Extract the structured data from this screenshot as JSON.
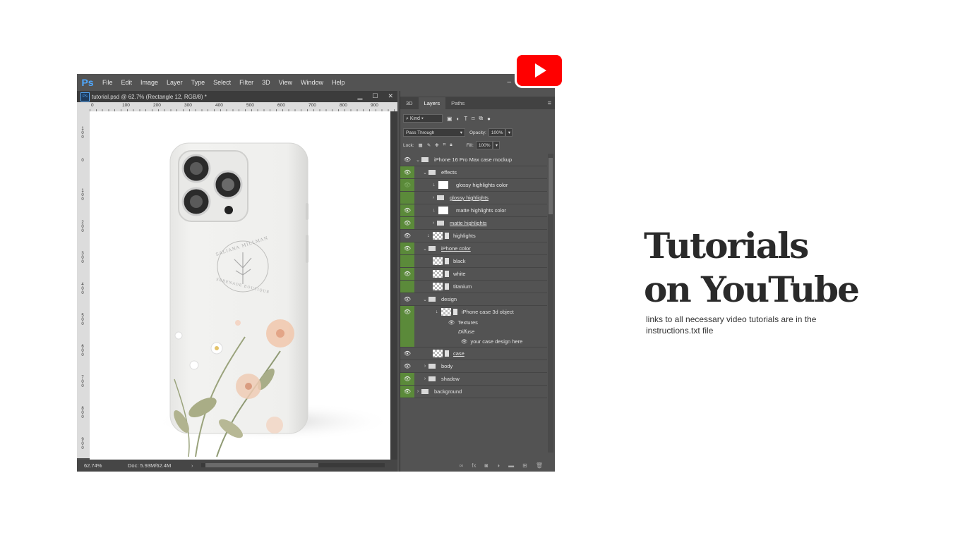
{
  "app": {
    "logo": "Ps",
    "menu": [
      "File",
      "Edit",
      "Image",
      "Layer",
      "Type",
      "Select",
      "Filter",
      "3D",
      "View",
      "Window",
      "Help"
    ]
  },
  "document": {
    "tab_title": "tutorial.psd @ 62.7% (Rectangle 12, RGB/8) *",
    "ruler_h": [
      "0",
      "100",
      "200",
      "300",
      "400",
      "500",
      "600",
      "700",
      "800",
      "900"
    ],
    "ruler_v": [
      "1\n0\n0",
      "0",
      "1\n0\n0",
      "2\n0\n0",
      "3\n0\n0",
      "4\n0\n0",
      "5\n0\n0",
      "6\n0\n0",
      "7\n0\n0",
      "8\n0\n0",
      "9\n0\n0"
    ],
    "status": {
      "zoom": "62.74%",
      "doc_info": "Doc: 5.93M/62.4M"
    }
  },
  "mockup_logo": {
    "top": "SALIANA MILLMAN",
    "bottom": "SERENADE BOUTIQUE"
  },
  "layers_panel": {
    "tabs": [
      "3D",
      "Layers",
      "Paths"
    ],
    "active_tab": "Layers",
    "filter_kind": "Kind",
    "blend_mode": "Pass Through",
    "opacity_label": "Opacity:",
    "opacity_value": "100%",
    "lock_label": "Lock:",
    "fill_label": "Fill:",
    "fill_value": "100%",
    "layers": [
      {
        "name": "iPhone 16 Pro Max case mockup",
        "type": "group",
        "expanded": true,
        "visible": true
      },
      {
        "name": "effects",
        "type": "group",
        "expanded": true,
        "visible": true
      },
      {
        "name": "glossy highlights color",
        "type": "fill",
        "visible": true
      },
      {
        "name": "glossy highlights",
        "type": "group",
        "expanded": false,
        "visible": false
      },
      {
        "name": "matte highlights color",
        "type": "fill",
        "visible": true
      },
      {
        "name": "matte highlights",
        "type": "group",
        "expanded": false,
        "visible": true
      },
      {
        "name": "highlights",
        "type": "smart",
        "visible": true
      },
      {
        "name": "iPhone color",
        "type": "group",
        "expanded": true,
        "visible": true
      },
      {
        "name": "black",
        "type": "smart",
        "visible": false
      },
      {
        "name": "white",
        "type": "smart",
        "visible": true
      },
      {
        "name": "titanium",
        "type": "smart",
        "visible": false
      },
      {
        "name": "design",
        "type": "group",
        "expanded": true,
        "visible": true
      },
      {
        "name": "iPhone case 3d object",
        "type": "3d",
        "visible": true
      },
      {
        "name": "Textures",
        "type": "sub",
        "visible": true
      },
      {
        "name": "Diffuse",
        "type": "sub",
        "visible": true
      },
      {
        "name": "your case design here",
        "type": "sub",
        "visible": true
      },
      {
        "name": "case",
        "type": "smart",
        "visible": true
      },
      {
        "name": "body",
        "type": "group",
        "expanded": false,
        "visible": true
      },
      {
        "name": "shadow",
        "type": "group",
        "expanded": false,
        "visible": true
      },
      {
        "name": "background",
        "type": "group",
        "expanded": false,
        "visible": true
      }
    ]
  },
  "promo": {
    "headline_line1": "Tutorials",
    "headline_line2": "on YouTube",
    "subtext": "links to all necessary video tutorials are in the instructions.txt file"
  },
  "colors": {
    "youtube": "#ff0000",
    "visibility_green": "#5b8a3a",
    "ps_blue": "#4fa8ff"
  }
}
